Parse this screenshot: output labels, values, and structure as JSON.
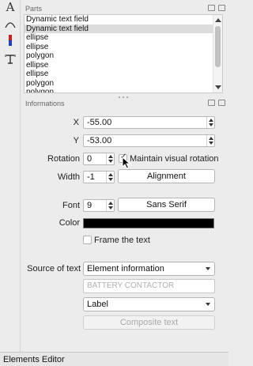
{
  "toolbar": {
    "tools": [
      {
        "icon": "text-tool-icon",
        "glyph": "A"
      },
      {
        "icon": "arc-tool-icon"
      },
      {
        "icon": "terminal-tool-icon"
      },
      {
        "icon": "dynamic-text-tool-icon"
      }
    ]
  },
  "parts": {
    "title": "Parts",
    "items": [
      "Dynamic text field",
      "Dynamic text field",
      "ellipse",
      "ellipse",
      "polygon",
      "ellipse",
      "ellipse",
      "polygon",
      "polygon"
    ],
    "selected_index": 1
  },
  "informations": {
    "title": "Informations",
    "x_label": "X",
    "x_value": "-55.00",
    "y_label": "Y",
    "y_value": "-53.00",
    "rotation_label": "Rotation",
    "rotation_value": "0",
    "maintain_rotation_label": "Maintain visual rotation",
    "maintain_rotation_checked": true,
    "width_label": "Width",
    "width_value": "-1",
    "alignment_button": "Alignment",
    "font_label": "Font",
    "font_size": "9",
    "font_button": "Sans Serif",
    "color_label": "Color",
    "color_value": "#000000",
    "frame_label": "Frame the text",
    "frame_checked": false,
    "source_label": "Source of text",
    "source_value": "Element information",
    "info_placeholder": "BATTERY CONTACTOR",
    "label_value": "Label",
    "composite_button": "Composite text"
  },
  "status": {
    "text": "Elements Editor"
  }
}
